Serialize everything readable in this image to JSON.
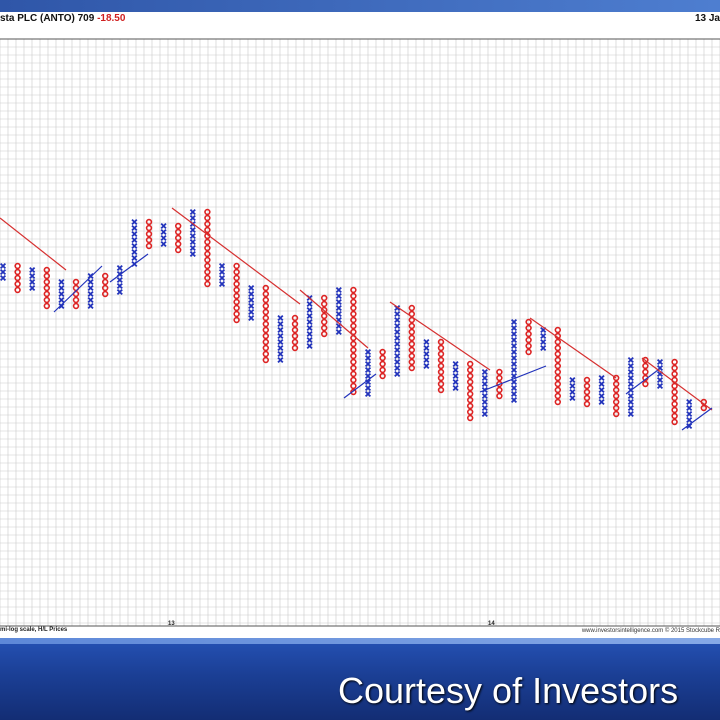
{
  "header": {
    "title": "sta PLC (ANTO) 709",
    "change": "-18.50",
    "date": "13 Ja"
  },
  "footer": {
    "scale_note": "mi-log scale, H/L Prices",
    "source": "www.investorsintelligence.com  © 2015 Stockcube R"
  },
  "chart_data": {
    "type": "point-and-figure",
    "x_tick_labels": [
      "13",
      "14"
    ],
    "x_marker": "o",
    "o_marker": "o",
    "symbols": {
      "rising": "X",
      "falling": "O"
    },
    "colors": {
      "x_column": "#2233bb",
      "o_column": "#dd2222",
      "resistance_line": "#d63030",
      "support_line": "#2233bb",
      "grid": "#c9c9c9"
    },
    "columns": [
      [
        "X",
        278,
        266
      ],
      [
        "O",
        266,
        290
      ],
      [
        "X",
        290,
        270
      ],
      [
        "O",
        270,
        306
      ],
      [
        "X",
        306,
        282
      ],
      [
        "O",
        282,
        306
      ],
      [
        "X",
        306,
        276
      ],
      [
        "O",
        276,
        294
      ],
      [
        "X",
        294,
        268
      ],
      [
        "X",
        268,
        222
      ],
      [
        "O",
        222,
        246
      ],
      [
        "X",
        246,
        226
      ],
      [
        "O",
        226,
        254
      ],
      [
        "X",
        254,
        212
      ],
      [
        "O",
        212,
        286
      ],
      [
        "X",
        286,
        266
      ],
      [
        "O",
        266,
        322
      ],
      [
        "X",
        322,
        288
      ],
      [
        "O",
        288,
        362
      ],
      [
        "X",
        362,
        318
      ],
      [
        "O",
        318,
        350
      ],
      [
        "X",
        350,
        298
      ],
      [
        "O",
        298,
        334
      ],
      [
        "X",
        334,
        290
      ],
      [
        "O",
        290,
        394
      ],
      [
        "X",
        394,
        352
      ],
      [
        "O",
        352,
        378
      ],
      [
        "X",
        378,
        308
      ],
      [
        "O",
        308,
        370
      ],
      [
        "X",
        370,
        342
      ],
      [
        "O",
        342,
        390
      ],
      [
        "X",
        390,
        364
      ],
      [
        "O",
        364,
        418
      ],
      [
        "X",
        418,
        372
      ],
      [
        "O",
        372,
        400
      ],
      [
        "X",
        400,
        322
      ],
      [
        "O",
        322,
        352
      ],
      [
        "X",
        352,
        330
      ],
      [
        "O",
        330,
        402
      ],
      [
        "X",
        402,
        380
      ],
      [
        "O",
        380,
        406
      ],
      [
        "X",
        406,
        378
      ],
      [
        "O",
        378,
        418
      ],
      [
        "X",
        418,
        360
      ],
      [
        "O",
        360,
        386
      ],
      [
        "X",
        386,
        362
      ],
      [
        "O",
        362,
        426
      ],
      [
        "X",
        426,
        402
      ],
      [
        "O",
        402,
        410
      ]
    ],
    "trend_lines": [
      {
        "kind": "resistance",
        "from": [
          0,
          218
        ],
        "to": [
          66,
          270
        ]
      },
      {
        "kind": "support",
        "from": [
          54,
          312
        ],
        "to": [
          102,
          266
        ]
      },
      {
        "kind": "support",
        "from": [
          110,
          282
        ],
        "to": [
          148,
          254
        ]
      },
      {
        "kind": "resistance",
        "from": [
          172,
          208
        ],
        "to": [
          300,
          304
        ]
      },
      {
        "kind": "resistance",
        "from": [
          300,
          290
        ],
        "to": [
          368,
          348
        ]
      },
      {
        "kind": "support",
        "from": [
          344,
          398
        ],
        "to": [
          376,
          374
        ]
      },
      {
        "kind": "resistance",
        "from": [
          390,
          302
        ],
        "to": [
          490,
          370
        ]
      },
      {
        "kind": "support",
        "from": [
          480,
          392
        ],
        "to": [
          546,
          366
        ]
      },
      {
        "kind": "resistance",
        "from": [
          530,
          318
        ],
        "to": [
          616,
          378
        ]
      },
      {
        "kind": "support",
        "from": [
          626,
          394
        ],
        "to": [
          658,
          370
        ]
      },
      {
        "kind": "resistance",
        "from": [
          642,
          358
        ],
        "to": [
          712,
          410
        ]
      },
      {
        "kind": "support",
        "from": [
          682,
          430
        ],
        "to": [
          712,
          408
        ]
      }
    ]
  }
}
